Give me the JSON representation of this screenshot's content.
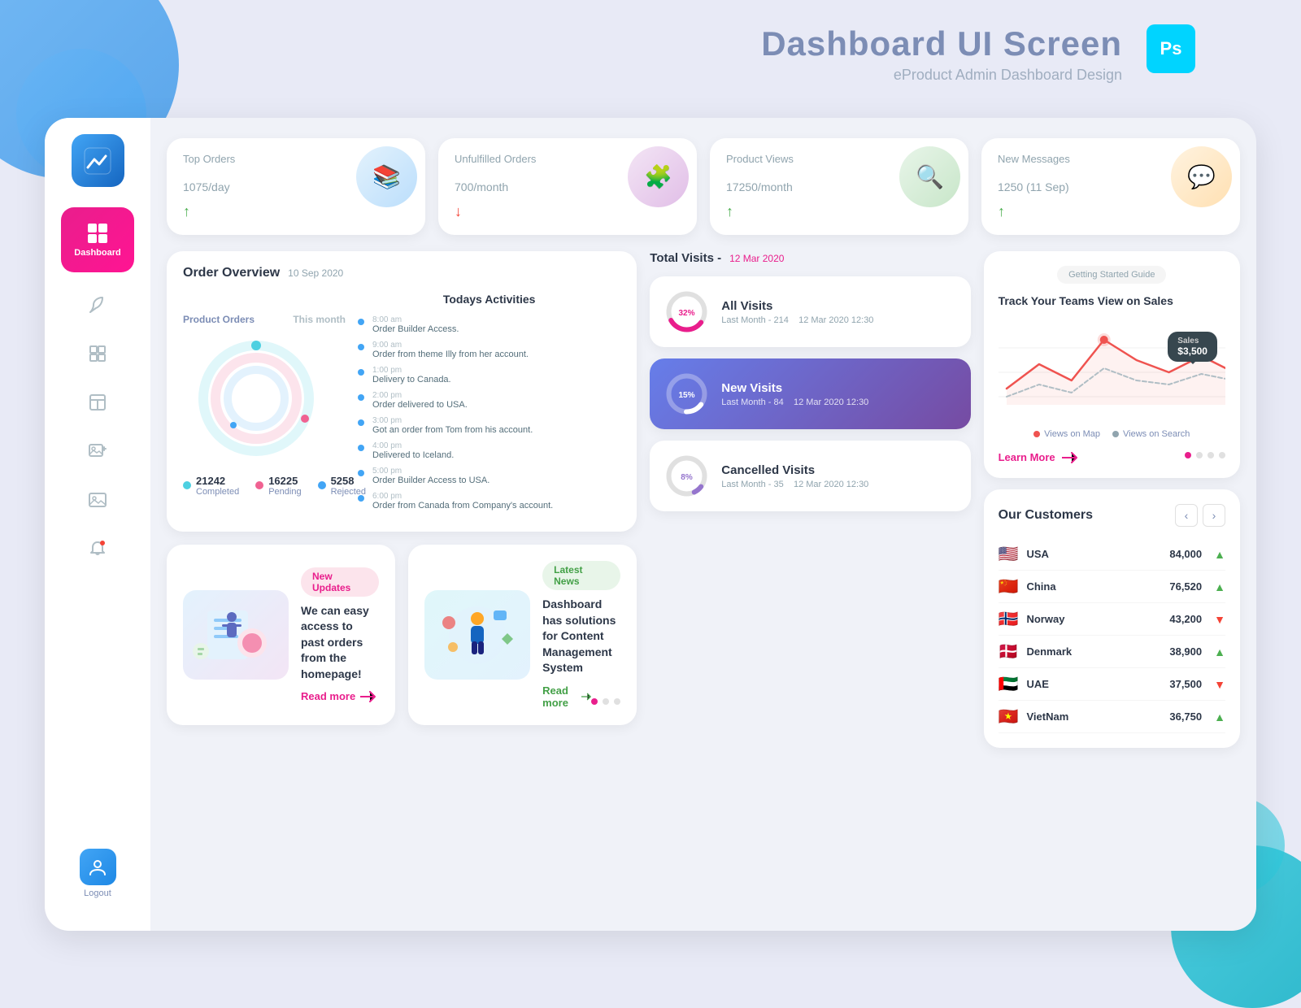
{
  "header": {
    "title": "Dashboard UI Screen",
    "subtitle": "eProduct Admin Dashboard Design",
    "ps_label": "Ps"
  },
  "sidebar": {
    "logo_icon": "chart-icon",
    "dashboard_label": "Dashboard",
    "nav_items": [
      {
        "name": "leaf-icon",
        "icon": "🍃"
      },
      {
        "name": "layers-icon",
        "icon": "⧉"
      },
      {
        "name": "layout-icon",
        "icon": "▣"
      },
      {
        "name": "add-image-icon",
        "icon": "🖼"
      },
      {
        "name": "image-icon",
        "icon": "📷"
      },
      {
        "name": "bell-icon",
        "icon": "🔔"
      }
    ],
    "logout_label": "Logout"
  },
  "stats": [
    {
      "label": "Top Orders",
      "value": "1075/",
      "unit": "day",
      "trend": "up",
      "icon": "📚"
    },
    {
      "label": "Unfulfilled Orders",
      "value": "700/",
      "unit": "month",
      "trend": "down",
      "icon": "🧩"
    },
    {
      "label": "Product Views",
      "value": "17250/",
      "unit": "month",
      "trend": "up",
      "icon": "🔍"
    },
    {
      "label": "New Messages",
      "value": "1250",
      "unit": " (11 Sep)",
      "trend": "up",
      "icon": "💬"
    }
  ],
  "order_overview": {
    "title": "Order Overview",
    "date": "10 Sep 2020",
    "product_orders_label": "Product Orders",
    "period_label": "This month",
    "donut": {
      "completed": 21242,
      "pending": 16225,
      "rejected": 5258,
      "completed_label": "Completed",
      "pending_label": "Pending",
      "rejected_label": "Rejected"
    },
    "activities_title": "Todays Activities",
    "activities": [
      {
        "time": "8:00 am",
        "text": "Order Builder Access."
      },
      {
        "time": "9:00 am",
        "text": "Order from theme Illy from her account."
      },
      {
        "time": "1:00 pm",
        "text": "Delivery to Canada."
      },
      {
        "time": "2:00 pm",
        "text": "Order delivered to USA."
      },
      {
        "time": "3:00 pm",
        "text": "Got an order from Tom from his account."
      },
      {
        "time": "4:00 pm",
        "text": "Delivered to Iceland."
      },
      {
        "time": "5:00 pm",
        "text": "Order Builder Access to USA."
      },
      {
        "time": "6:00 pm",
        "text": "Order from Canada from Company's account."
      }
    ]
  },
  "total_visits": {
    "title": "Total Visits",
    "date": "12 Mar 2020",
    "all_visits": {
      "title": "All Visits",
      "last_month_label": "Last Month - 214",
      "date": "12 Mar 2020 12:30",
      "percent": 32
    },
    "new_visits": {
      "title": "New Visits",
      "last_month_label": "Last Month - 84",
      "date": "12 Mar 2020 12:30",
      "percent": 15
    },
    "cancelled_visits": {
      "title": "Cancelled Visits",
      "last_month_label": "Last Month - 35",
      "date": "12 Mar 2020 12:30",
      "percent": 8
    }
  },
  "sales_chart": {
    "guide_label": "Getting Started Guide",
    "title": "Track Your Teams View on Sales",
    "tooltip_value": "$3,500",
    "tooltip_label": "Sales",
    "legend": [
      {
        "label": "Views on Map",
        "color": "#f44336"
      },
      {
        "label": "Views on Search",
        "color": "#90a4ae"
      }
    ],
    "learn_more_label": "Learn More"
  },
  "customers": {
    "title": "Our Customers",
    "list": [
      {
        "country": "USA",
        "flag": "🇺🇸",
        "value": "84,000",
        "trend": "up"
      },
      {
        "country": "China",
        "flag": "🇨🇳",
        "value": "76,520",
        "trend": "up"
      },
      {
        "country": "Norway",
        "flag": "🇳🇴",
        "value": "43,200",
        "trend": "down"
      },
      {
        "country": "Denmark",
        "flag": "🇩🇰",
        "value": "38,900",
        "trend": "up"
      },
      {
        "country": "UAE",
        "flag": "🇦🇪",
        "value": "37,500",
        "trend": "down"
      },
      {
        "country": "VietNam",
        "flag": "🇻🇳",
        "value": "36,750",
        "trend": "up"
      }
    ]
  },
  "news": [
    {
      "badge": "New Updates",
      "badge_type": "pink",
      "text": "We can easy access to past orders from the homepage!",
      "read_more": "Read more"
    },
    {
      "badge": "Latest News",
      "badge_type": "green",
      "text": "Dashboard has solutions for Content Management System",
      "read_more": "Read more",
      "dots": 3
    }
  ]
}
